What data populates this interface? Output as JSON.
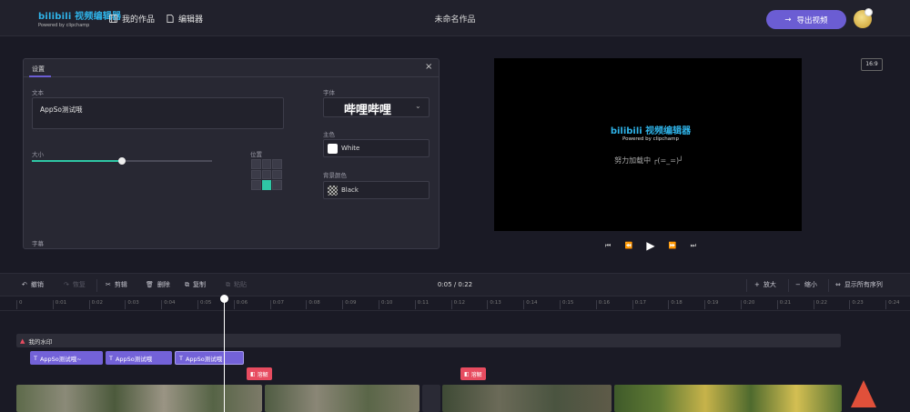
{
  "header": {
    "logo_main": "bilibili 视频编辑器",
    "logo_sub": "Powered by clipchamp",
    "nav_works": "我的作品",
    "nav_editor": "编辑器",
    "project_title": "未命名作品",
    "export_label": "导出视频"
  },
  "settings": {
    "tab_label": "设置",
    "text_label": "文本",
    "text_value": "AppSo测试哦",
    "size_label": "大小",
    "size_level": 0.5,
    "position_label": "位置",
    "font_label": "字体",
    "font_value": "哔哩哔哩",
    "main_color_label": "主色",
    "main_color_value": "White",
    "bg_color_label": "背景颜色",
    "bg_color_value": "Black",
    "subtitle_label": "字幕"
  },
  "preview": {
    "logo_main": "bilibili 视频编辑器",
    "logo_sub": "Powered by clipchamp",
    "loading_text": "努力加载中 ┌(=_=)┘",
    "aspect_ratio": "16:9"
  },
  "toolbar": {
    "undo": "撤销",
    "redo": "恢复",
    "cut": "剪辑",
    "delete": "删除",
    "copy": "复制",
    "paste": "粘贴",
    "time": "0:05 / 0:22",
    "zoom_in": "放大",
    "zoom_out": "缩小",
    "show_all": "显示所有序列"
  },
  "timeline": {
    "ruler": [
      "0",
      "0:01",
      "0:02",
      "0:03",
      "0:04",
      "0:05",
      "0:06",
      "0:07",
      "0:08",
      "0:09",
      "0:10",
      "0:11",
      "0:12",
      "0:13",
      "0:14",
      "0:15",
      "0:16",
      "0:17",
      "0:18",
      "0:19",
      "0:20",
      "0:21",
      "0:22",
      "0:23",
      "0:24"
    ],
    "watermark_track": "我的水印",
    "text_clips": [
      "AppSo测试哦~",
      "AppSo测试哦",
      "AppSo测试哦"
    ],
    "transitions": [
      "溶解",
      "溶解"
    ]
  },
  "colors": {
    "accent": "#6b5dd3",
    "selection": "#2fc7a5",
    "transition": "#e74c60",
    "brand": "#2fb3e8"
  }
}
